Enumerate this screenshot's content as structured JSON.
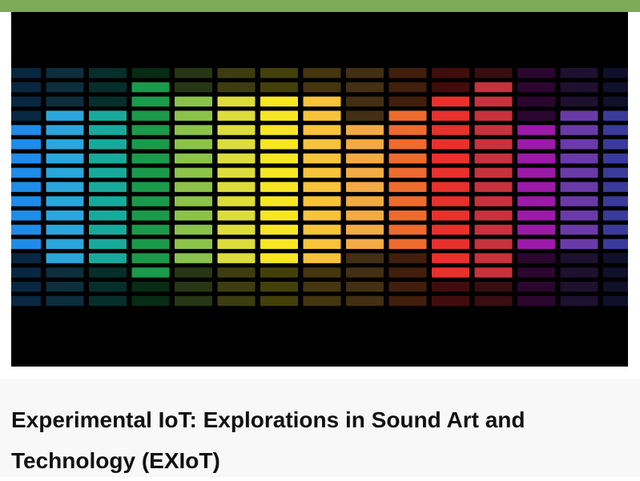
{
  "header": {
    "accent_color": "#7caa55"
  },
  "card": {
    "image": {
      "semantic": "equalizer-graphic",
      "background": "#000000"
    },
    "title": "Experimental IoT: Explorations in Sound Art and Technology (EXIoT)"
  },
  "equalizer": {
    "bands": [
      {
        "color": "#1e8ce8",
        "level": 0.55
      },
      {
        "color": "#2aa6dc",
        "level": 0.66
      },
      {
        "color": "#17aa9c",
        "level": 0.66
      },
      {
        "color": "#1a9a4a",
        "level": 0.8
      },
      {
        "color": "#8bc34a",
        "level": 0.73
      },
      {
        "color": "#dcdc3c",
        "level": 0.73
      },
      {
        "color": "#f6e623",
        "level": 0.73
      },
      {
        "color": "#f7c33a",
        "level": 0.68
      },
      {
        "color": "#f2aa45",
        "level": 0.5
      },
      {
        "color": "#ee6b2e",
        "level": 0.6
      },
      {
        "color": "#e8302c",
        "level": 0.75
      },
      {
        "color": "#c8323c",
        "level": 0.8
      },
      {
        "color": "#9c1aa8",
        "level": 0.55
      },
      {
        "color": "#6a3aa8",
        "level": 0.58
      },
      {
        "color": "#3a3a9c",
        "level": 0.58
      }
    ]
  }
}
